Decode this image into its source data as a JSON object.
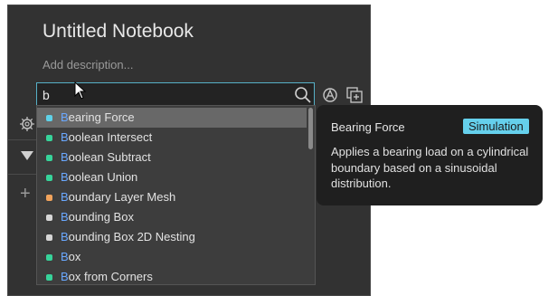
{
  "notebook": {
    "title": "Untitled Notebook",
    "description_placeholder": "Add description..."
  },
  "search": {
    "query": "b",
    "match_prefix": "B"
  },
  "results": [
    {
      "prefix": "B",
      "rest": "earing Force",
      "color": "#5fd2e8",
      "selected": true
    },
    {
      "prefix": "B",
      "rest": "oolean Intersect",
      "color": "#37d39a",
      "selected": false
    },
    {
      "prefix": "B",
      "rest": "oolean Subtract",
      "color": "#37d39a",
      "selected": false
    },
    {
      "prefix": "B",
      "rest": "oolean Union",
      "color": "#37d39a",
      "selected": false
    },
    {
      "prefix": "B",
      "rest": "oundary Layer Mesh",
      "color": "#f1a35c",
      "selected": false
    },
    {
      "prefix": "B",
      "rest": "ounding Box",
      "color": "#d6d6d6",
      "selected": false
    },
    {
      "prefix": "B",
      "rest": "ounding Box 2D Nesting",
      "color": "#d6d6d6",
      "selected": false
    },
    {
      "prefix": "B",
      "rest": "ox",
      "color": "#37d39a",
      "selected": false
    },
    {
      "prefix": "B",
      "rest": "ox from Corners",
      "color": "#37d39a",
      "selected": false
    }
  ],
  "tooltip": {
    "title": "Bearing Force",
    "badge": "Simulation",
    "description": "Applies a bearing load on a cylindrical boundary based on a sinusoidal distribution."
  },
  "colors": {
    "accent": "#56b0c7",
    "badge": "#65d0ec",
    "highlight_text": "#6aa8ff"
  },
  "icons": {
    "search": "search-icon",
    "tool1": "refresh-icon",
    "tool2": "add-layer-icon",
    "side1": "gear-icon",
    "side2": "triangle-down-icon",
    "side3": "plus-icon"
  }
}
